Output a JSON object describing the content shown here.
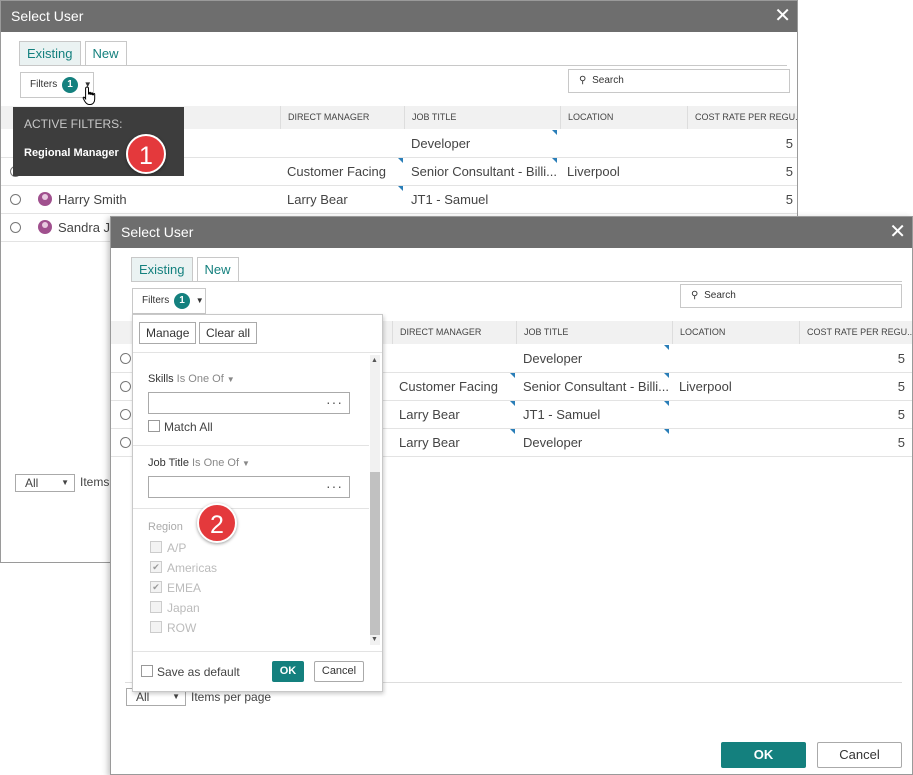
{
  "back_dialog": {
    "title": "Select User",
    "tabs": [
      "Existing",
      "New"
    ],
    "filters_label": "Filters",
    "filters_count": "1",
    "search_placeholder": "Search",
    "columns": [
      "DIRECT MANAGER",
      "JOB TITLE",
      "LOCATION",
      "COST RATE PER REGU..."
    ],
    "rows": [
      {
        "name": "",
        "manager": "",
        "job": "Developer",
        "location": "",
        "rate": "5"
      },
      {
        "name": "",
        "manager": "Customer Facing",
        "job": "Senior Consultant - Billi...",
        "location": "Liverpool",
        "rate": "5"
      },
      {
        "name": "Harry Smith",
        "manager": "Larry Bear",
        "job": "JT1 - Samuel",
        "location": "",
        "rate": "5"
      },
      {
        "name": "Sandra Jo",
        "manager": "",
        "job": "",
        "location": "",
        "rate": ""
      }
    ],
    "items_per_page_value": "All",
    "items_per_page_label": "Items"
  },
  "active_filters_popup": {
    "heading": "ACTIVE FILTERS:",
    "value": "Regional Manager"
  },
  "callouts": [
    "1",
    "2"
  ],
  "front_dialog": {
    "title": "Select User",
    "tabs": [
      "Existing",
      "New"
    ],
    "filters_label": "Filters",
    "filters_count": "1",
    "search_placeholder": "Search",
    "columns": [
      "DIRECT MANAGER",
      "JOB TITLE",
      "LOCATION",
      "COST RATE PER REGU..."
    ],
    "rows": [
      {
        "manager": "",
        "job": "Developer",
        "location": "",
        "rate": "5"
      },
      {
        "manager": "Customer Facing",
        "job": "Senior Consultant - Billi...",
        "location": "Liverpool",
        "rate": "5"
      },
      {
        "manager": "Larry Bear",
        "job": "JT1 - Samuel",
        "location": "",
        "rate": "5"
      },
      {
        "manager": "Larry Bear",
        "job": "Developer",
        "location": "",
        "rate": "5"
      }
    ],
    "items_per_page_value": "All",
    "items_per_page_label": "Items per page",
    "ok_label": "OK",
    "cancel_label": "Cancel"
  },
  "filter_panel": {
    "manage_label": "Manage",
    "clear_all_label": "Clear all",
    "skills_label": "Skills",
    "skills_operator": "Is One Of",
    "match_all_label": "Match All",
    "job_title_label": "Job Title",
    "job_title_operator": "Is One Of",
    "region_label": "Region",
    "regions": [
      {
        "name": "A/P",
        "checked": false
      },
      {
        "name": "Americas",
        "checked": true
      },
      {
        "name": "EMEA",
        "checked": true
      },
      {
        "name": "Japan",
        "checked": false
      },
      {
        "name": "ROW",
        "checked": false
      }
    ],
    "save_default_label": "Save as default",
    "ok_label": "OK",
    "cancel_label": "Cancel"
  },
  "colors": {
    "accent": "#14807e",
    "titlebar": "#6e6e6e",
    "callout": "#e4393c",
    "link_tri": "#2a7eb8"
  }
}
